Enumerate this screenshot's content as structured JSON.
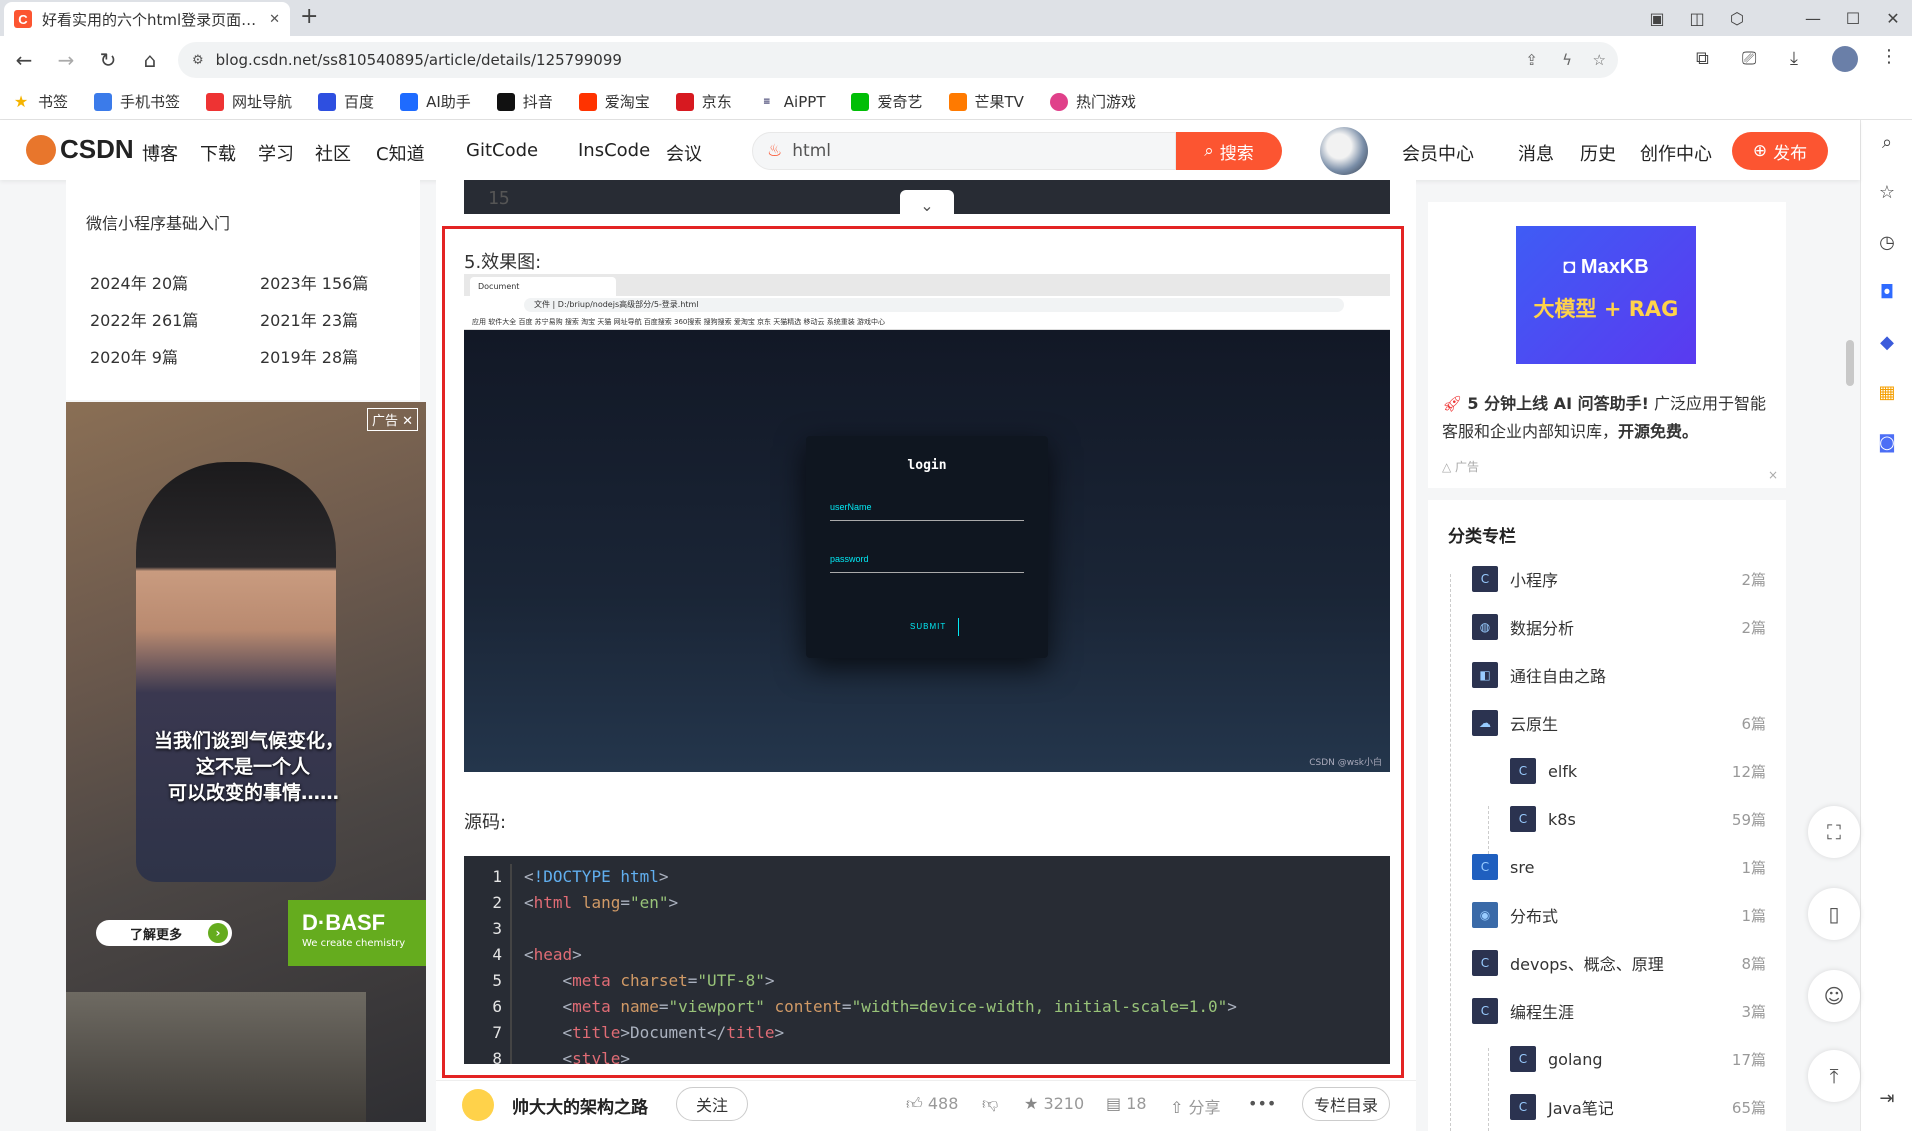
{
  "browser": {
    "tab_title": "好看实用的六个html登录页面_登",
    "tab_close": "✕",
    "new_tab": "+",
    "url": "blog.csdn.net/ss810540895/article/details/125799099",
    "bookmarks": [
      "书签",
      "手机书签",
      "网址导航",
      "百度",
      "AI助手",
      "抖音",
      "爱淘宝",
      "京东",
      "AiPPT",
      "爱奇艺",
      "芒果TV",
      "热门游戏"
    ]
  },
  "header": {
    "logo": "CSDN",
    "nav": [
      "博客",
      "下载",
      "学习",
      "社区",
      "C知道",
      "GitCode",
      "InsCode",
      "会议"
    ],
    "search_value": "html",
    "search_button": "搜索",
    "right_nav": [
      "会员中心",
      "消息",
      "历史",
      "创作中心"
    ],
    "publish": "发布"
  },
  "left": {
    "top_link": "微信小程序基础入门",
    "archives": [
      "2024年 20篇",
      "2023年 156篇",
      "2022年 261篇",
      "2021年 23篇",
      "2020年 9篇",
      "2019年 28篇"
    ],
    "ad_tag": "广告",
    "ad_lines": [
      "当我们谈到气候变化，",
      "这不是一个人",
      "可以改变的事情……"
    ],
    "ad_button": "了解更多",
    "basf_name": "D·BASF",
    "basf_tag": "We create chemistry"
  },
  "article": {
    "prev_code_line": "15",
    "section1": "5.效果图:",
    "section2": "源码:",
    "mini": {
      "tab": "Document",
      "path": "文件 | D:/briup/nodejs高级部分/5-登录.html",
      "bookmarks": "应用  软件大全  百度  苏宁易购  搜索  淘宝  天猫  网址导航  百度搜索  360搜索  搜狗搜索  爱淘宝  京东  天猫精选  移动云  系统重装  游戏中心",
      "login_title": "login",
      "username": "userName",
      "password": "password",
      "submit": "SUBMIT",
      "watermark": "CSDN @wsk小白"
    },
    "code_lines": [
      {
        "n": "1"
      },
      {
        "n": "2"
      },
      {
        "n": "3"
      },
      {
        "n": "4"
      },
      {
        "n": "5"
      },
      {
        "n": "6"
      },
      {
        "n": "7"
      },
      {
        "n": "8"
      }
    ]
  },
  "author": {
    "name": "帅大大的架构之路",
    "follow": "关注",
    "likes": "488",
    "stars": "3210",
    "comments": "18",
    "share": "分享",
    "more": "•••",
    "toc": "专栏目录"
  },
  "right": {
    "ad_title1": "MaxKB",
    "ad_title2": "大模型 + RAG",
    "ad_desc_bold": "5 分钟上线 AI 问答助手!",
    "ad_desc": "广泛应用于智能客服和企业内部知识库，",
    "ad_desc_bold2": "开源免费。",
    "ad_label": "广告",
    "ad_close": "×",
    "cat_title": "分类专栏",
    "categories": [
      {
        "name": "小程序",
        "count": "2篇"
      },
      {
        "name": "数据分析",
        "count": "2篇"
      },
      {
        "name": "通往自由之路",
        "count": ""
      },
      {
        "name": "云原生",
        "count": "6篇"
      },
      {
        "name": "elfk",
        "count": "12篇"
      },
      {
        "name": "k8s",
        "count": "59篇"
      },
      {
        "name": "sre",
        "count": "1篇"
      },
      {
        "name": "分布式",
        "count": "1篇"
      },
      {
        "name": "devops、概念、原理",
        "count": "8篇"
      },
      {
        "name": "编程生涯",
        "count": "3篇"
      },
      {
        "name": "golang",
        "count": "17篇"
      },
      {
        "name": "Java笔记",
        "count": "65篇"
      }
    ]
  },
  "colors": {
    "csdn_red": "#fc5531",
    "highlight_border": "#e32323",
    "code_bg": "#282c34"
  }
}
